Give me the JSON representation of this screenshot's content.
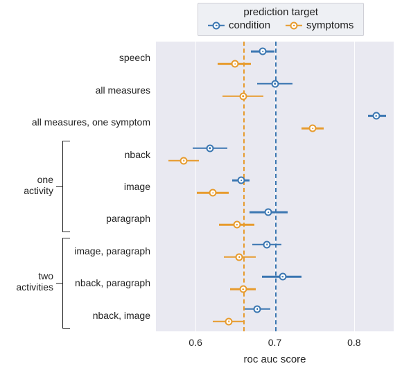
{
  "chart_data": {
    "type": "dot-error",
    "xlabel": "roc auc score",
    "xlim": [
      0.55,
      0.85
    ],
    "xticks": [
      0.6,
      0.7,
      0.8
    ],
    "legend_title": "prediction target",
    "colors": {
      "condition": "#3a76b1",
      "symptoms": "#e79b2d"
    },
    "reflines": {
      "condition": 0.7,
      "symptoms": 0.66
    },
    "categories": [
      "speech",
      "all measures",
      "all measures, one symptom",
      "nback",
      "image",
      "paragraph",
      "image, paragraph",
      "nback, paragraph",
      "nback, image"
    ],
    "groups": [
      {
        "label": "one\nactivity",
        "rows": [
          3,
          4,
          5
        ]
      },
      {
        "label": "two\nactivities",
        "rows": [
          6,
          7,
          8
        ]
      }
    ],
    "series": [
      {
        "name": "condition",
        "points": [
          {
            "mean": 0.685,
            "lo": 0.67,
            "hi": 0.7
          },
          {
            "mean": 0.7,
            "lo": 0.678,
            "hi": 0.722
          },
          {
            "mean": 0.828,
            "lo": 0.818,
            "hi": 0.84
          },
          {
            "mean": 0.618,
            "lo": 0.596,
            "hi": 0.64
          },
          {
            "mean": 0.658,
            "lo": 0.646,
            "hi": 0.668
          },
          {
            "mean": 0.692,
            "lo": 0.668,
            "hi": 0.716
          },
          {
            "mean": 0.69,
            "lo": 0.672,
            "hi": 0.708
          },
          {
            "mean": 0.71,
            "lo": 0.684,
            "hi": 0.734
          },
          {
            "mean": 0.678,
            "lo": 0.662,
            "hi": 0.694
          }
        ]
      },
      {
        "name": "symptoms",
        "points": [
          {
            "mean": 0.65,
            "lo": 0.628,
            "hi": 0.67
          },
          {
            "mean": 0.66,
            "lo": 0.634,
            "hi": 0.686
          },
          {
            "mean": 0.748,
            "lo": 0.734,
            "hi": 0.762
          },
          {
            "mean": 0.585,
            "lo": 0.566,
            "hi": 0.604
          },
          {
            "mean": 0.622,
            "lo": 0.602,
            "hi": 0.642
          },
          {
            "mean": 0.652,
            "lo": 0.63,
            "hi": 0.674
          },
          {
            "mean": 0.655,
            "lo": 0.636,
            "hi": 0.676
          },
          {
            "mean": 0.66,
            "lo": 0.644,
            "hi": 0.676
          },
          {
            "mean": 0.642,
            "lo": 0.622,
            "hi": 0.662
          }
        ]
      }
    ]
  }
}
